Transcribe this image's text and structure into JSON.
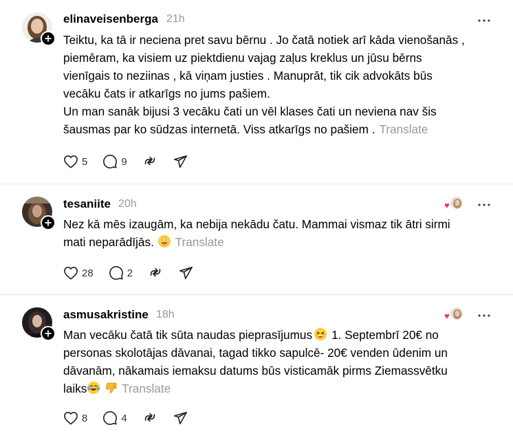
{
  "posts": [
    {
      "username": "elinaveisenberga",
      "time": "21h",
      "text": [
        "Teiktu, ka tā ir neciena pret savu bērnu . Jo čatā notiek arī kāda vienošanās ,",
        "piemēram, ka visiem uz piektdienu vajag zaļus kreklus un jūsu bērns",
        "vienīgais to neziinas , kā viņam justies . Manuprāt, tik cik advokāts būs",
        "vecāku čats ir atkarīgs no jums pašiem.",
        "Un man sanāk bijusi 3 vecāku čati un vēl klases čati un neviena nav šis",
        "šausmas par ko sūdzas internetā. Viss atkarīgs no pašiem ."
      ],
      "translate": "Translate",
      "likes": "5",
      "replies": "9",
      "avatar_color": "#c9a48a"
    },
    {
      "username": "tesaniite",
      "time": "20h",
      "text": [
        "Nez kā mēs izaugām, ka nebija nekādu čatu. Mammai vismaz tik ātri sirmi",
        "mati neparādījās."
      ],
      "translate": "Translate",
      "likes": "28",
      "replies": "2",
      "avatar_color": "#5a4a3a"
    },
    {
      "username": "asmusakristine",
      "time": "18h",
      "text": [
        "Man vecāku čatā tik sūta naudas pieprasījumus",
        "1. Septembrī 20€ no",
        "personas skolotājas dāvanai, tagad tikko sapulcē- 20€ venden ūdenim un",
        "dāvanām, nākamais iemaksu datums būs visticamāk pirms Ziemassvētku",
        "laiks"
      ],
      "translate": "Translate",
      "likes": "8",
      "replies": "4",
      "avatar_color": "#2c2a2c"
    }
  ],
  "icons": {
    "like": "heart-outline-icon",
    "reply": "comment-bubble-icon",
    "repost": "repost-arrows-icon",
    "share": "send-paper-plane-icon",
    "more": "more-horizontal-icon",
    "follow": "plus-icon"
  },
  "colors": {
    "meta_gray": "#999999",
    "liked_red": "#ff3040",
    "divider": "#e5e5e5"
  }
}
